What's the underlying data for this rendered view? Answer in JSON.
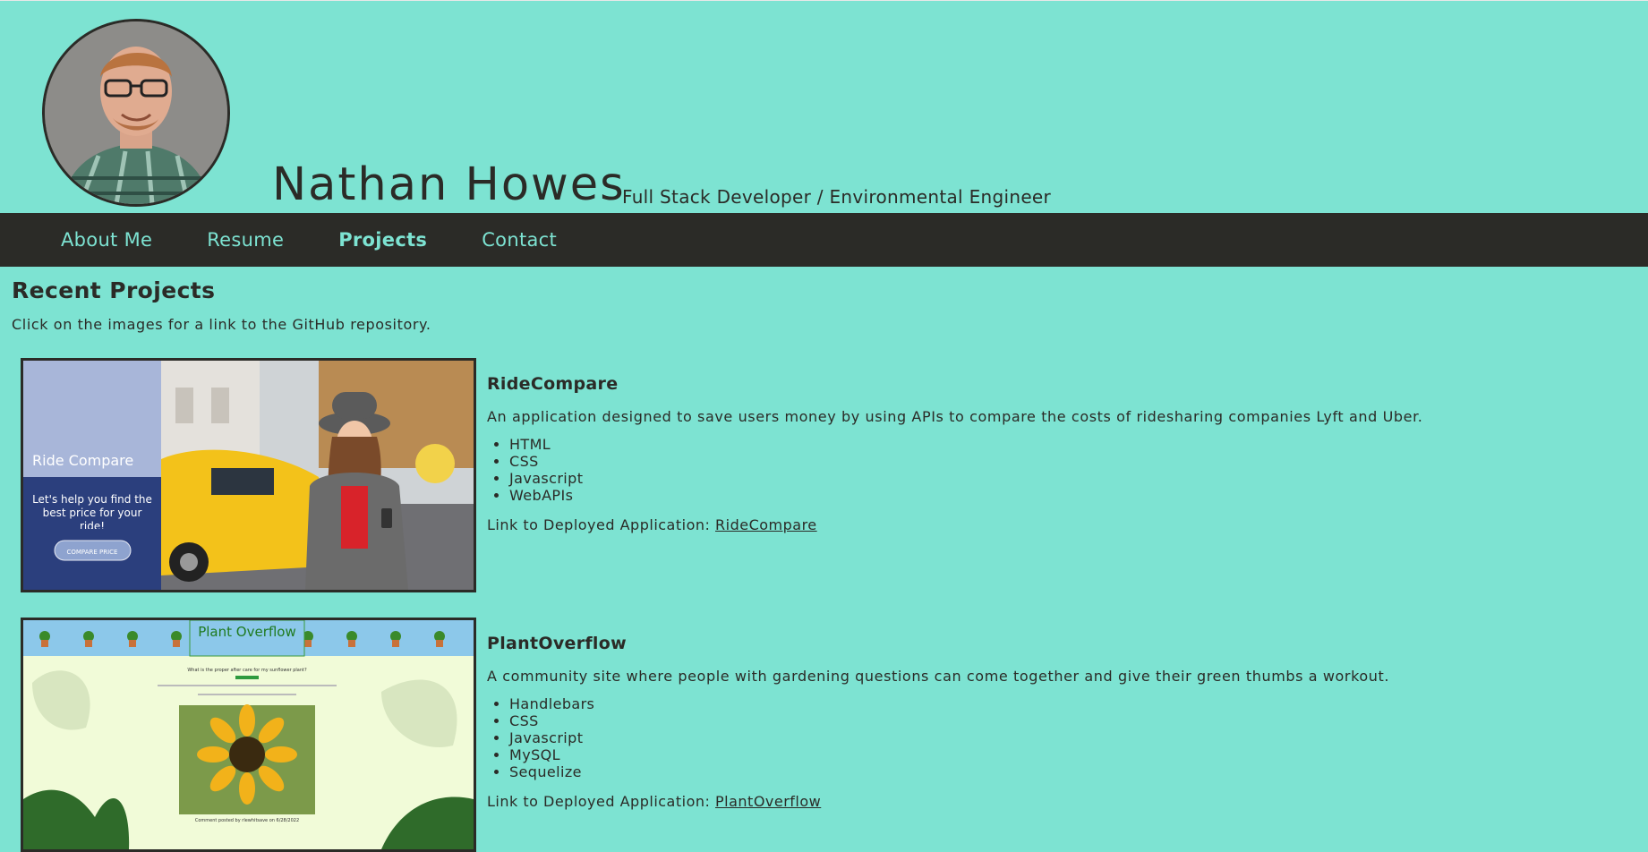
{
  "header": {
    "name": "Nathan Howes",
    "tagline": "Full Stack Developer / Environmental Engineer"
  },
  "nav": {
    "items": [
      {
        "label": "About Me",
        "active": false
      },
      {
        "label": "Resume",
        "active": false
      },
      {
        "label": "Projects",
        "active": true
      },
      {
        "label": "Contact",
        "active": false
      }
    ]
  },
  "projects_section": {
    "title": "Recent Projects",
    "intro": "Click on the images for a link to the GitHub repository.",
    "projects": [
      {
        "title": "RideCompare",
        "description": "An application designed to save users money by using APIs to compare the costs of ridesharing companies Lyft and Uber.",
        "technologies": [
          "HTML",
          "CSS",
          "Javascript",
          "WebAPIs"
        ],
        "link_prefix": "Link to Deployed Application:",
        "link_text": "RideCompare",
        "screenshot": {
          "app_title": "Ride Compare",
          "tagline": "Let's help you find the best price for your ride!",
          "button_label": "COMPARE PRICE"
        }
      },
      {
        "title": "PlantOverflow",
        "description": "A community site where people with gardening questions can come together and give their green thumbs a workout.",
        "technologies": [
          "Handlebars",
          "CSS",
          "Javascript",
          "MySQL",
          "Sequelize"
        ],
        "link_prefix": "Link to Deployed Application:",
        "link_text": "PlantOverflow",
        "screenshot": {
          "app_title": "Plant Overflow",
          "question": "What is the proper after care for my sunflower plant?",
          "comment_meta": "Comment posted by rlewhitsave on 6/28/2022"
        }
      }
    ]
  },
  "colors": {
    "background": "#7de3d2",
    "nav_background": "#2b2b27",
    "text": "#2b2b27"
  }
}
